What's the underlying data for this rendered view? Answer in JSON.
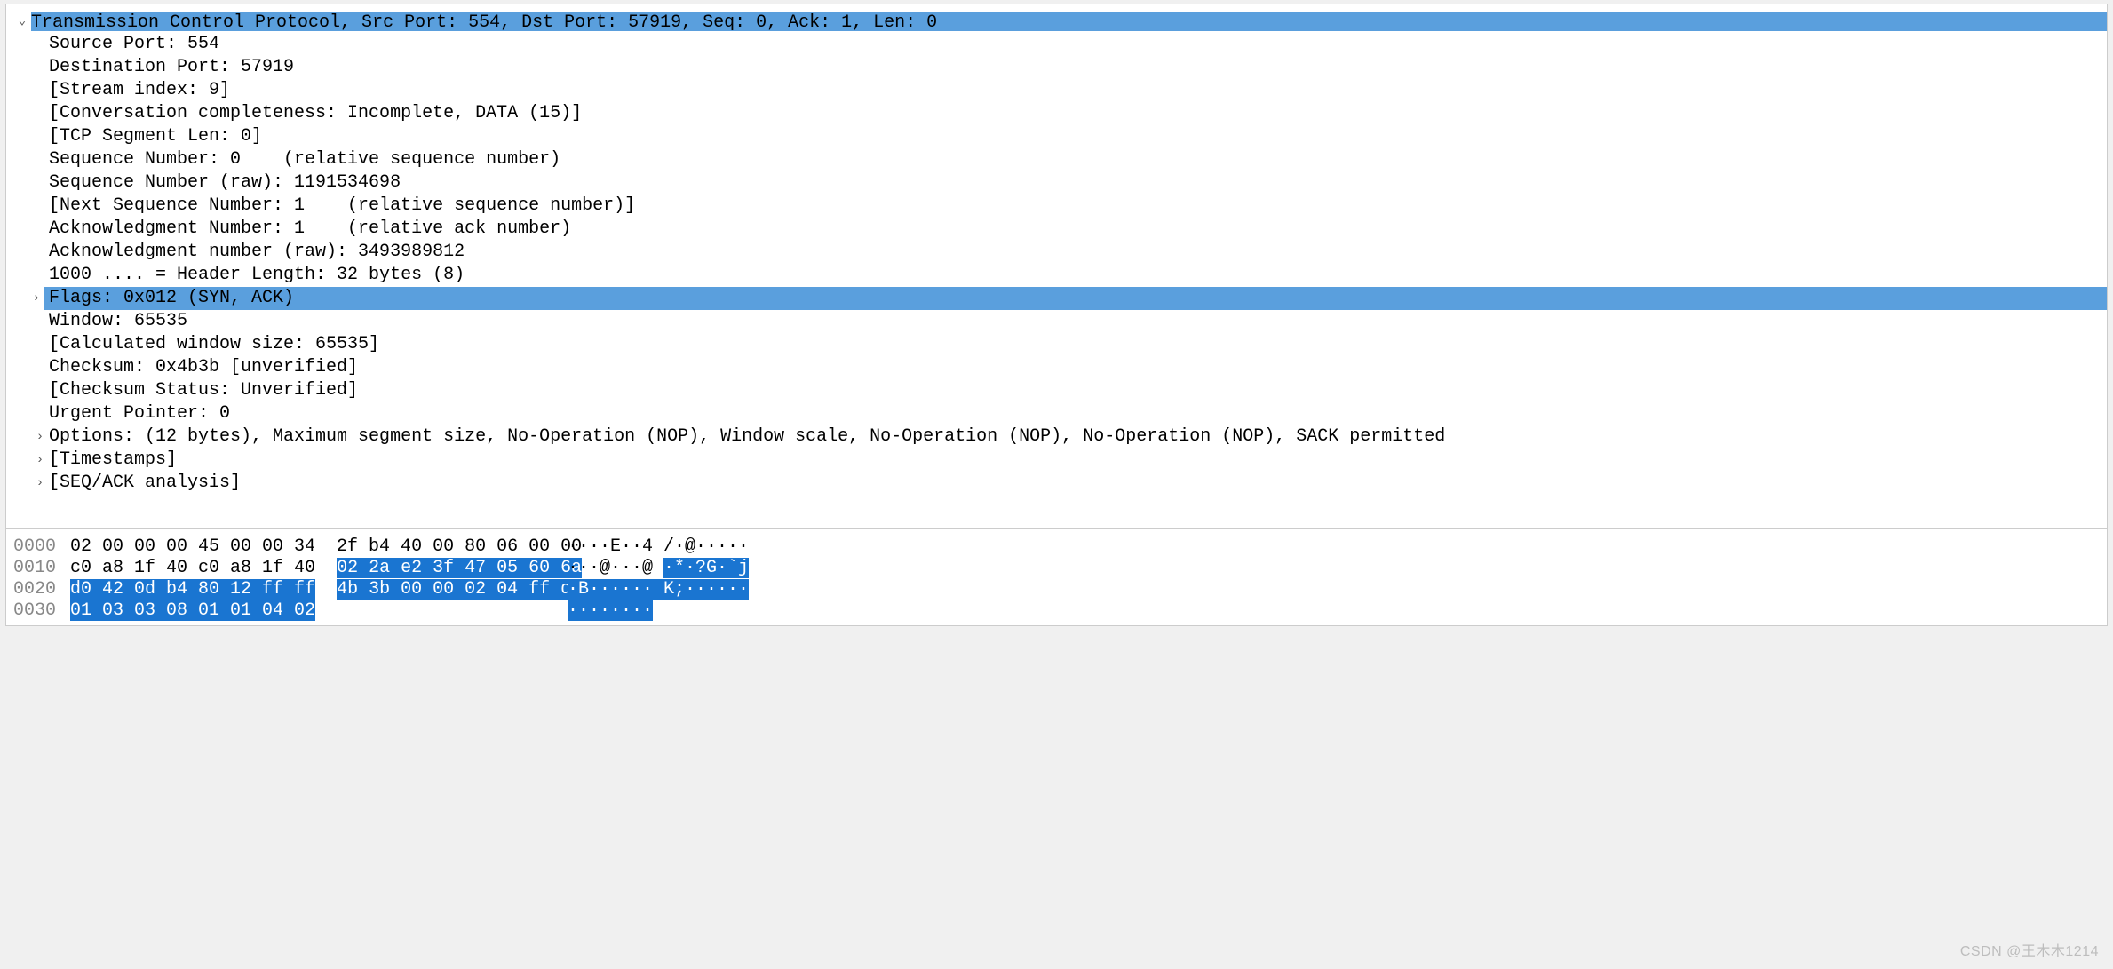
{
  "protocol": {
    "header_line": "Transmission Control Protocol, Src Port: 554, Dst Port: 57919, Seq: 0, Ack: 1, Len: 0",
    "fields": {
      "source_port": "Source Port: 554",
      "dest_port": "Destination Port: 57919",
      "stream_index": "[Stream index: 9]",
      "conv_completeness": "[Conversation completeness: Incomplete, DATA (15)]",
      "tcp_seg_len": "[TCP Segment Len: 0]",
      "seq_num": "Sequence Number: 0    (relative sequence number)",
      "seq_num_raw": "Sequence Number (raw): 1191534698",
      "next_seq": "[Next Sequence Number: 1    (relative sequence number)]",
      "ack_num": "Acknowledgment Number: 1    (relative ack number)",
      "ack_num_raw": "Acknowledgment number (raw): 3493989812",
      "header_len": "1000 .... = Header Length: 32 bytes (8)",
      "flags": "Flags: 0x012 (SYN, ACK)",
      "window": "Window: 65535",
      "calc_window": "[Calculated window size: 65535]",
      "checksum": "Checksum: 0x4b3b [unverified]",
      "checksum_status": "[Checksum Status: Unverified]",
      "urgent_ptr": "Urgent Pointer: 0",
      "options": "Options: (12 bytes), Maximum segment size, No-Operation (NOP), Window scale, No-Operation (NOP), No-Operation (NOP), SACK permitted",
      "timestamps": "[Timestamps]",
      "seq_ack_analysis": "[SEQ/ACK analysis]"
    }
  },
  "hexdump": {
    "rows": [
      {
        "offset": "0000",
        "left_plain": "02 00 00 00 45 00 00 34 ",
        "left_hl": "",
        "right_plain": " 2f b4 40 00 80 06 00 00",
        "right_hl": "",
        "ascii_plain_l": "····E··4 /·@·····",
        "ascii_hl": "",
        "ascii_plain_r": ""
      },
      {
        "offset": "0010",
        "left_plain": "c0 a8 1f 40 c0 a8 1f 40 ",
        "left_hl": "",
        "right_plain": " ",
        "right_hl": "02 2a e2 3f 47 05 60 6a",
        "ascii_plain_l": "···@···@ ",
        "ascii_hl": "·*·?G·`j",
        "ascii_plain_r": ""
      },
      {
        "offset": "0020",
        "left_plain": "",
        "left_hl": "d0 42 0d b4 80 12 ff ff",
        "right_plain": "  ",
        "right_hl": "4b 3b 00 00 02 04 ff d7",
        "ascii_plain_l": "",
        "ascii_hl": "·B······ K;······",
        "ascii_plain_r": ""
      },
      {
        "offset": "0030",
        "left_plain": "",
        "left_hl": "01 03 03 08 01 01 04 02",
        "right_plain": "",
        "right_hl": "",
        "ascii_plain_l": "",
        "ascii_hl": "········",
        "ascii_plain_r": ""
      }
    ]
  },
  "carets": {
    "down": "⌄",
    "right": "›"
  },
  "watermark": "CSDN @王木木1214"
}
